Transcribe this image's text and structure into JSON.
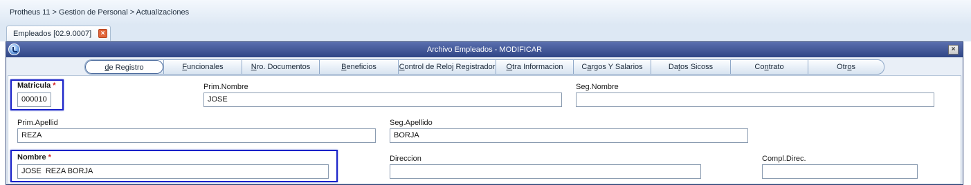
{
  "breadcrumb": "Protheus 11 > Gestion de Personal > Actualizaciones",
  "doc_tab": {
    "label": "Empleados [02.9.0007]",
    "close_glyph": "×"
  },
  "window": {
    "title": "Archivo Empleados - MODIFICAR",
    "close_glyph": "×"
  },
  "tabs": [
    {
      "pre": "",
      "u": "d",
      "post": "e Registro"
    },
    {
      "pre": "",
      "u": "F",
      "post": "uncionales"
    },
    {
      "pre": "",
      "u": "N",
      "post": "ro. Documentos"
    },
    {
      "pre": "",
      "u": "B",
      "post": "eneficios"
    },
    {
      "pre": "",
      "u": "C",
      "post": "ontrol de Reloj Registrador"
    },
    {
      "pre": "",
      "u": "O",
      "post": "tra Informacion"
    },
    {
      "pre": "C",
      "u": "a",
      "post": "rgos Y Salarios"
    },
    {
      "pre": "Da",
      "u": "t",
      "post": "os Sicoss"
    },
    {
      "pre": "Co",
      "u": "n",
      "post": "trato"
    },
    {
      "pre": "Otr",
      "u": "o",
      "post": "s"
    }
  ],
  "fields": {
    "matricula": {
      "label": "Matricula",
      "required_mark": "*",
      "value": "000010"
    },
    "prim_nombre": {
      "label": "Prim.Nombre",
      "value": "JOSE"
    },
    "seg_nombre": {
      "label": "Seg.Nombre",
      "value": ""
    },
    "prim_apellid": {
      "label": "Prim.Apellid",
      "value": "REZA"
    },
    "seg_apellido": {
      "label": "Seg.Apellido",
      "value": "BORJA"
    },
    "nombre": {
      "label": "Nombre",
      "required_mark": "*",
      "value": "JOSE  REZA BORJA"
    },
    "direccion": {
      "label": "Direccion",
      "value": ""
    },
    "compl_direc": {
      "label": "Compl.Direc.",
      "value": ""
    }
  },
  "colors": {
    "titlebar": "#2f4585",
    "highlight_border": "#1a22c9",
    "required_star": "#d02020",
    "close_tab": "#e2653a"
  }
}
